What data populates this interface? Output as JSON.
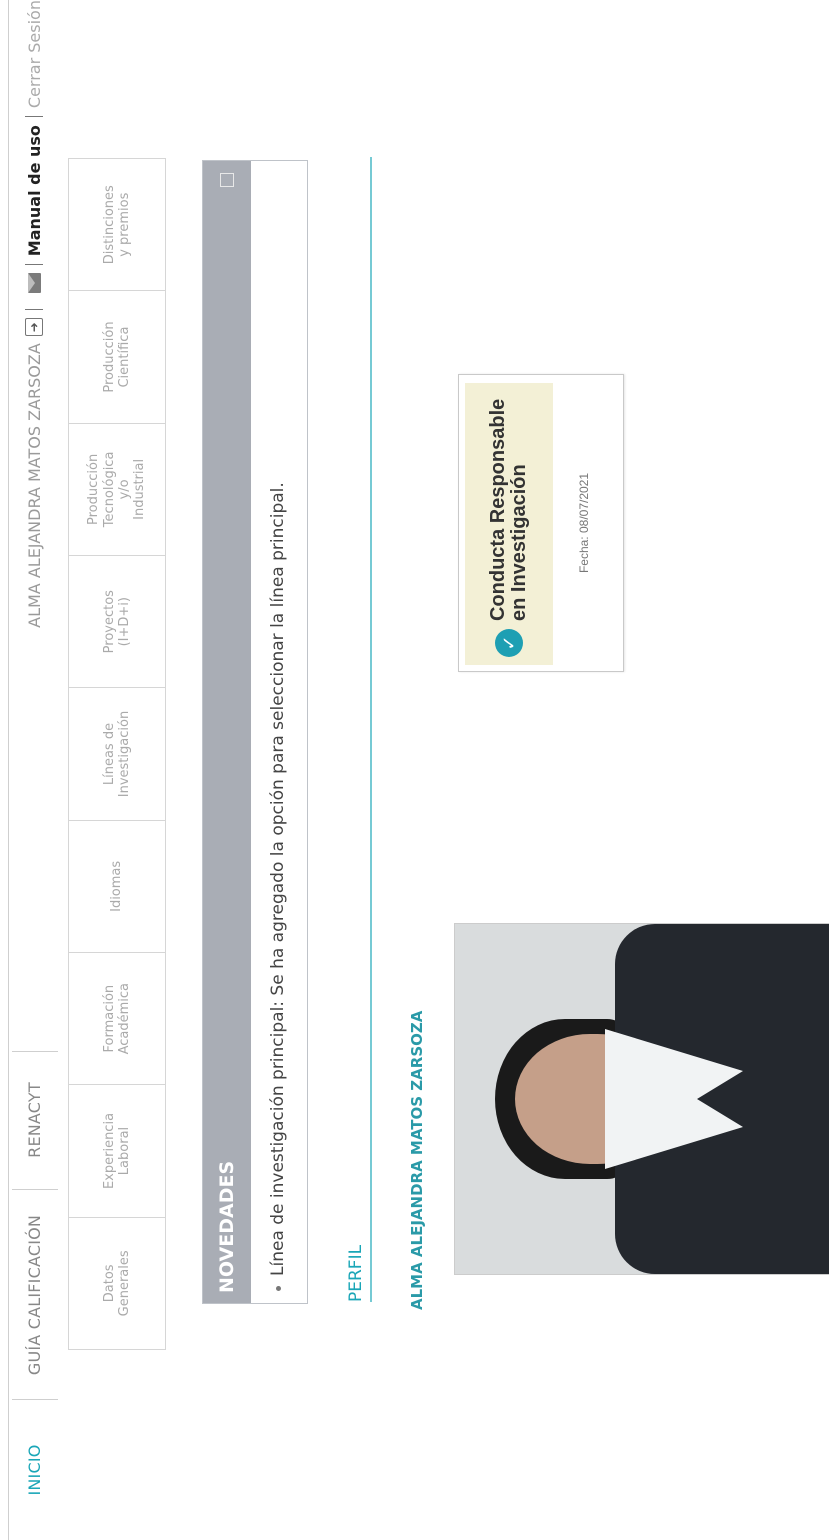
{
  "topnav": {
    "tabs": [
      "INICIO",
      "GUÍA CALIFICACIÓN",
      "RENACYT"
    ],
    "user_name": "ALMA ALEJANDRA MATOS ZARSOZA",
    "manual_label": "Manual de uso",
    "logout_label": "Cerrar Sesión"
  },
  "subtabs": [
    "Datos\nGenerales",
    "Experiencia\nLaboral",
    "Formación\nAcadémica",
    "Idiomas",
    "Líneas de\nInvestigación",
    "Proyectos\n(I+D+i)",
    "Producción\nTecnológica\ny/o\nIndustrial",
    "Producción\nCientífica",
    "Distinciones\ny premios"
  ],
  "news": {
    "title": "NOVEDADES",
    "item": "Línea de investigación principal: Se ha agregado la opción para seleccionar la línea principal."
  },
  "perfil": {
    "label": "PERFIL",
    "name": "ALMA ALEJANDRA MATOS ZARSOZA"
  },
  "badge": {
    "title": "Conducta Responsable\nen Investigación",
    "date": "Fecha: 08/07/2021"
  }
}
